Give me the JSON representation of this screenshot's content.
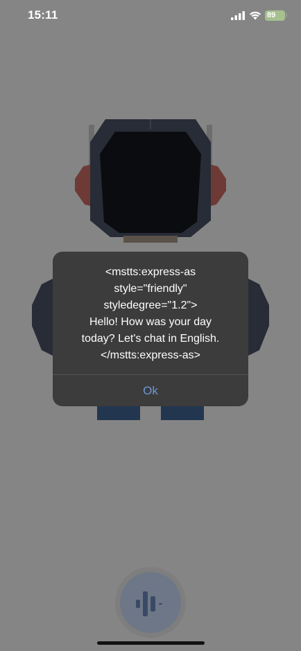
{
  "status_bar": {
    "time": "15:11",
    "battery": "89",
    "battery_icon": "battery-charging-icon",
    "signal_icon": "cellular-signal-icon",
    "wifi_icon": "wifi-icon"
  },
  "alert": {
    "message": "<mstts:express-as\nstyle=\"friendly\"\nstyledegree=\"1.2\">\nHello! How was your day\ntoday? Let's chat in English.\n</mstts:express-as>",
    "ok_label": "Ok"
  },
  "mic": {
    "icon": "audio-waveform-icon"
  },
  "colors": {
    "dim_background": "#858585",
    "alert_background": "#3c3c3c",
    "alert_button_text": "#6f98d8",
    "battery_fill": "#a6c08f"
  }
}
